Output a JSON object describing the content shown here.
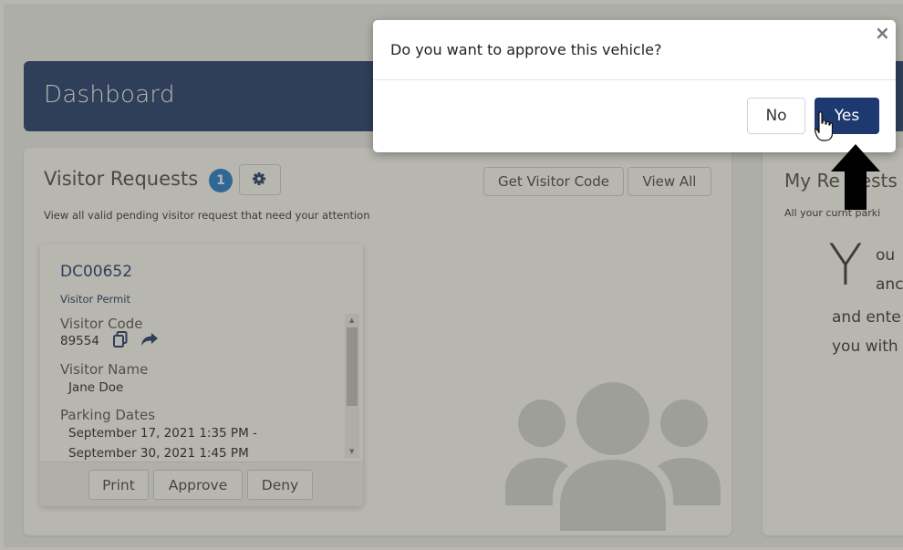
{
  "header": {
    "title": "Dashboard"
  },
  "visitor_requests": {
    "title": "Visitor Requests",
    "badge_count": "1",
    "subtitle": "View all valid pending visitor request that need your attention",
    "get_code_label": "Get Visitor Code",
    "view_all_label": "View All",
    "permit": {
      "id": "DC00652",
      "type": "Visitor Permit",
      "code_label": "Visitor Code",
      "code_value": "89554",
      "name_label": "Visitor Name",
      "name_value": "Jane Doe",
      "dates_label": "Parking Dates",
      "date_start": "September 17, 2021 1:35 PM -",
      "date_end": "September 30, 2021 1:45 PM",
      "actions": {
        "print": "Print",
        "approve": "Approve",
        "deny": "Deny"
      }
    }
  },
  "my_requests": {
    "title": "My Re",
    "title_end": "ests",
    "subtitle": "All your cur",
    "subtitle_end": "nt parki",
    "big_letter": "Y",
    "line1": "ou",
    "line2": "anc",
    "line3": "and ente",
    "line4": "you with"
  },
  "modal": {
    "question": "Do you want to approve this vehicle?",
    "close": "×",
    "no_label": "No",
    "yes_label": "Yes"
  },
  "colors": {
    "navy": "#1d3970",
    "badge_blue": "#1f7ed4"
  }
}
